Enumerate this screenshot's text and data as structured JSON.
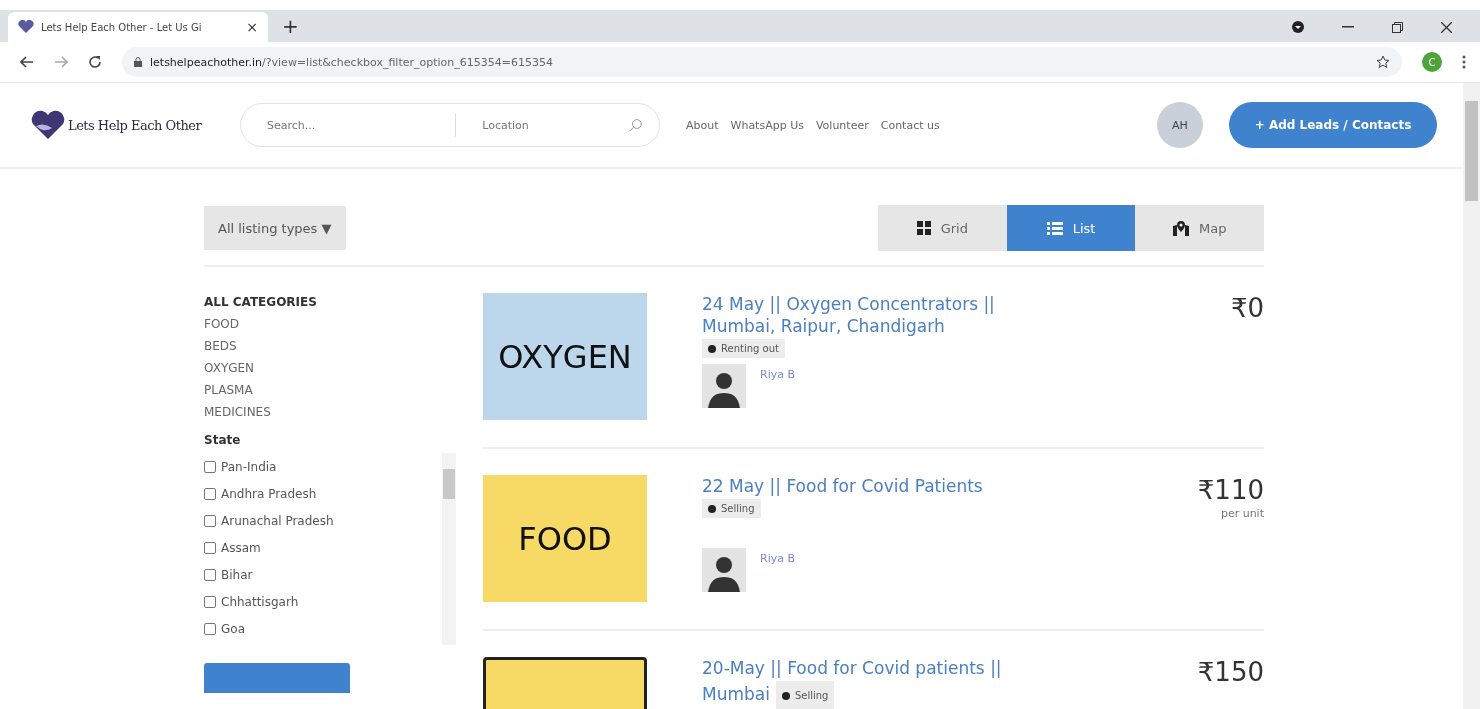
{
  "browser": {
    "tab_title": "Lets Help Each Other - Let Us Gi",
    "tab_close": "×",
    "new_tab": "+",
    "url_host": "letshelpeachother.in",
    "url_path": "/?view=list&checkbox_filter_option_615354=615354",
    "profile_initial": "C"
  },
  "site": {
    "logo_text": "Lets Help Each Other",
    "search_placeholder": "Search...",
    "location_placeholder": "Location",
    "nav": [
      "About",
      "WhatsApp Us",
      "Volunteer",
      "Contact us"
    ],
    "avatar": "AH",
    "add_button": "+ Add Leads / Contacts"
  },
  "filter": {
    "listing_types": "All listing types ▼"
  },
  "views": [
    {
      "kind": "grid",
      "label": "Grid",
      "selected": false
    },
    {
      "kind": "list",
      "label": "List",
      "selected": true
    },
    {
      "kind": "map",
      "label": "Map",
      "selected": false
    }
  ],
  "sidebar": {
    "categories_heading": "ALL CATEGORIES",
    "categories": [
      "FOOD",
      "BEDS",
      "OXYGEN",
      "PLASMA",
      "MEDICINES"
    ],
    "state_heading": "State",
    "states": [
      {
        "label": "Pan-India",
        "checked": false
      },
      {
        "label": "Andhra Pradesh",
        "checked": false
      },
      {
        "label": "Arunachal Pradesh",
        "checked": false
      },
      {
        "label": "Assam",
        "checked": false
      },
      {
        "label": "Bihar",
        "checked": false
      },
      {
        "label": "Chhattisgarh",
        "checked": false
      },
      {
        "label": "Goa",
        "checked": false
      }
    ]
  },
  "listings": [
    {
      "image_label": "OXYGEN",
      "color": "#bcd6ec",
      "title": "24 May || Oxygen Concentrators || Mumbai, Raipur, Chandigarh",
      "badge": "Renting out",
      "author": "Riya B",
      "price": "₹0"
    },
    {
      "image_label": "FOOD",
      "color": "#f7d966",
      "title": "22 May || Food for Covid Patients",
      "badge": "Selling",
      "author": "Riya B",
      "price": "₹110",
      "unit": "per unit"
    },
    {
      "color": "#f7d966",
      "title": "20-May || Food for Covid patients || Mumbai",
      "badge": "Selling",
      "price": "₹150"
    }
  ]
}
